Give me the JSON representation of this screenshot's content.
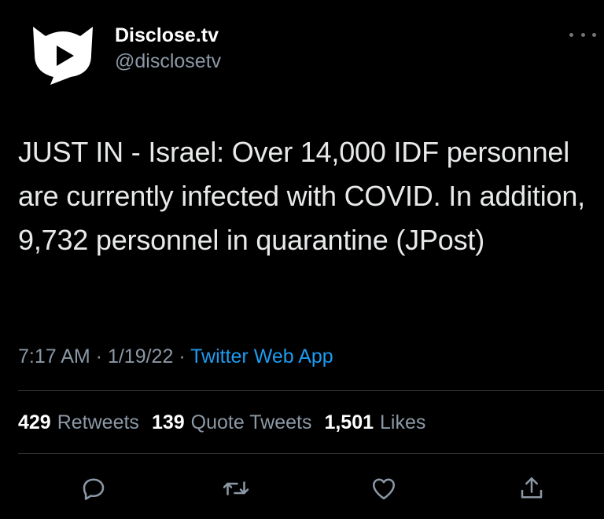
{
  "author": {
    "display_name": "Disclose.tv",
    "handle": "@disclosetv",
    "avatar_icon": "disclose-tv-logo-icon"
  },
  "tweet": {
    "text": "JUST IN - Israel: Over 14,000 IDF personnel are currently infected with COVID. In addition, 9,732 personnel in quarantine (JPost)"
  },
  "meta": {
    "time": "7:17 AM",
    "separator1": " · ",
    "date": "1/19/22",
    "separator2": " · ",
    "source": "Twitter Web App"
  },
  "stats": {
    "retweets_count": "429",
    "retweets_label": "Retweets",
    "quotes_count": "139",
    "quotes_label": "Quote Tweets",
    "likes_count": "1,501",
    "likes_label": "Likes"
  },
  "actions": [
    {
      "icon": "reply-icon"
    },
    {
      "icon": "retweet-icon"
    },
    {
      "icon": "like-icon"
    },
    {
      "icon": "share-icon"
    }
  ],
  "colors": {
    "background": "#000000",
    "text": "#e7e9ea",
    "secondary": "#8b98a5",
    "link": "#1d9bf0",
    "divider": "#2f3336"
  }
}
